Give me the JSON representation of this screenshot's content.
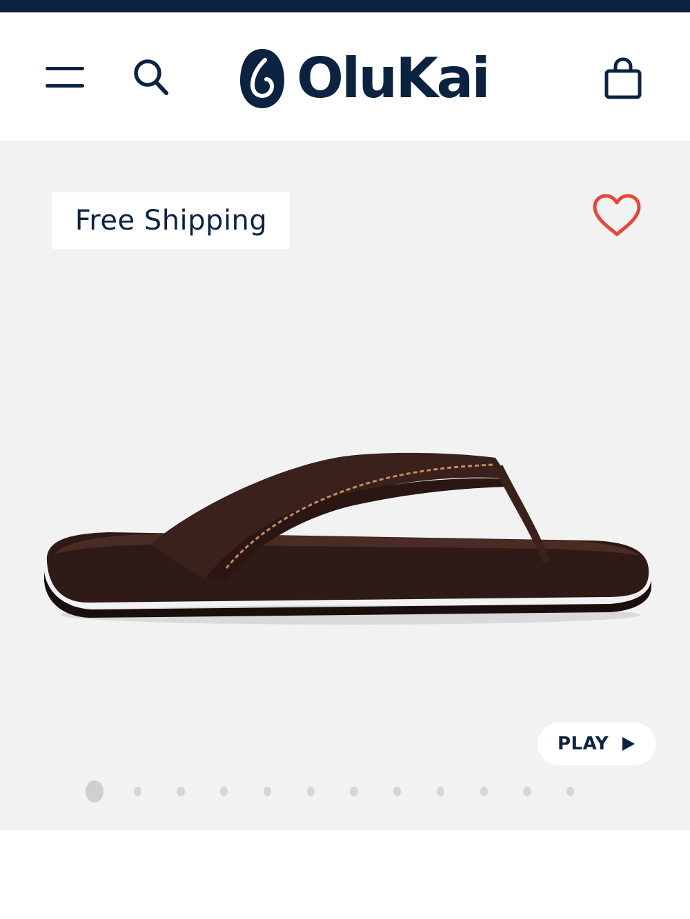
{
  "header": {
    "brand": "OluKai",
    "menu_icon": "hamburger-menu-icon",
    "search_icon": "search-icon",
    "cart_icon": "shopping-bag-icon"
  },
  "gallery": {
    "badge": "Free Shipping",
    "wishlist_icon": "heart-outline-icon",
    "product_image_alt": "dark brown leather flip-flop sandal",
    "play_label": "PLAY",
    "play_icon": "play-triangle-icon",
    "slide_count": 12,
    "active_slide": 1
  },
  "colors": {
    "brand_navy": "#0b2341",
    "heart_red": "#e5473c",
    "gallery_bg": "#f2f2f2"
  }
}
